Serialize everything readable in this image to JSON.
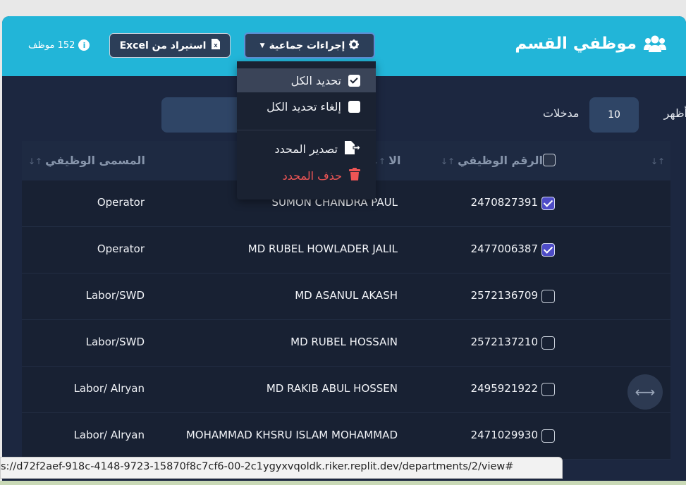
{
  "header": {
    "title": "موظفي القسم",
    "actions_label": "إجراءات جماعية",
    "excel_label": "استيراد من Excel",
    "count_label": "152 موظف"
  },
  "table_controls": {
    "show_label": "أظهر",
    "entries_value": "10",
    "entries_label": "مدخلات"
  },
  "table": {
    "headers": {
      "id": "الرقم الوظيفي",
      "name": "الا",
      "job_title": "المسمى الوظيفي"
    },
    "rows": [
      {
        "id": "2470827391",
        "name": "SUMON CHANDRA PAUL",
        "title": "Operator",
        "checked": true
      },
      {
        "id": "2477006387",
        "name": "MD RUBEL HOWLADER JALIL",
        "title": "Operator",
        "checked": true
      },
      {
        "id": "2572136709",
        "name": "MD ASANUL AKASH",
        "title": "Labor/SWD",
        "checked": false
      },
      {
        "id": "2572137210",
        "name": "MD RUBEL HOSSAIN",
        "title": "Labor/SWD",
        "checked": false
      },
      {
        "id": "2495921922",
        "name": "MD RAKIB ABUL HOSSEN",
        "title": "Labor/ Alryan",
        "checked": false
      },
      {
        "id": "2471029930",
        "name": "MOHAMMAD KHSRU ISLAM MOHAMMAD",
        "title": "Labor/ Alryan",
        "checked": false
      }
    ]
  },
  "dropdown": {
    "select_all": "تحديد الكل",
    "deselect_all": "إلغاء تحديد الكل",
    "export_selected": "تصدير المحدد",
    "delete_selected": "حذف المحدد"
  },
  "statusbar": {
    "url": "s://d72f2aef-918c-4148-9723-15870f8c7cf6-00-2c1ygyxvqoldk.riker.replit.dev/departments/2/view#"
  },
  "colors": {
    "header_bg": "#22b5d8",
    "body_bg": "#1c2740",
    "danger": "#ee5555",
    "checkbox_checked": "#4e4cc7"
  },
  "icons": [
    "users-icon",
    "gear-icon",
    "caret-down-icon",
    "excel-file-icon",
    "info-icon",
    "check-square-icon",
    "square-icon",
    "file-export-icon",
    "trash-icon",
    "sort-icon",
    "arrows-horizontal-icon"
  ]
}
